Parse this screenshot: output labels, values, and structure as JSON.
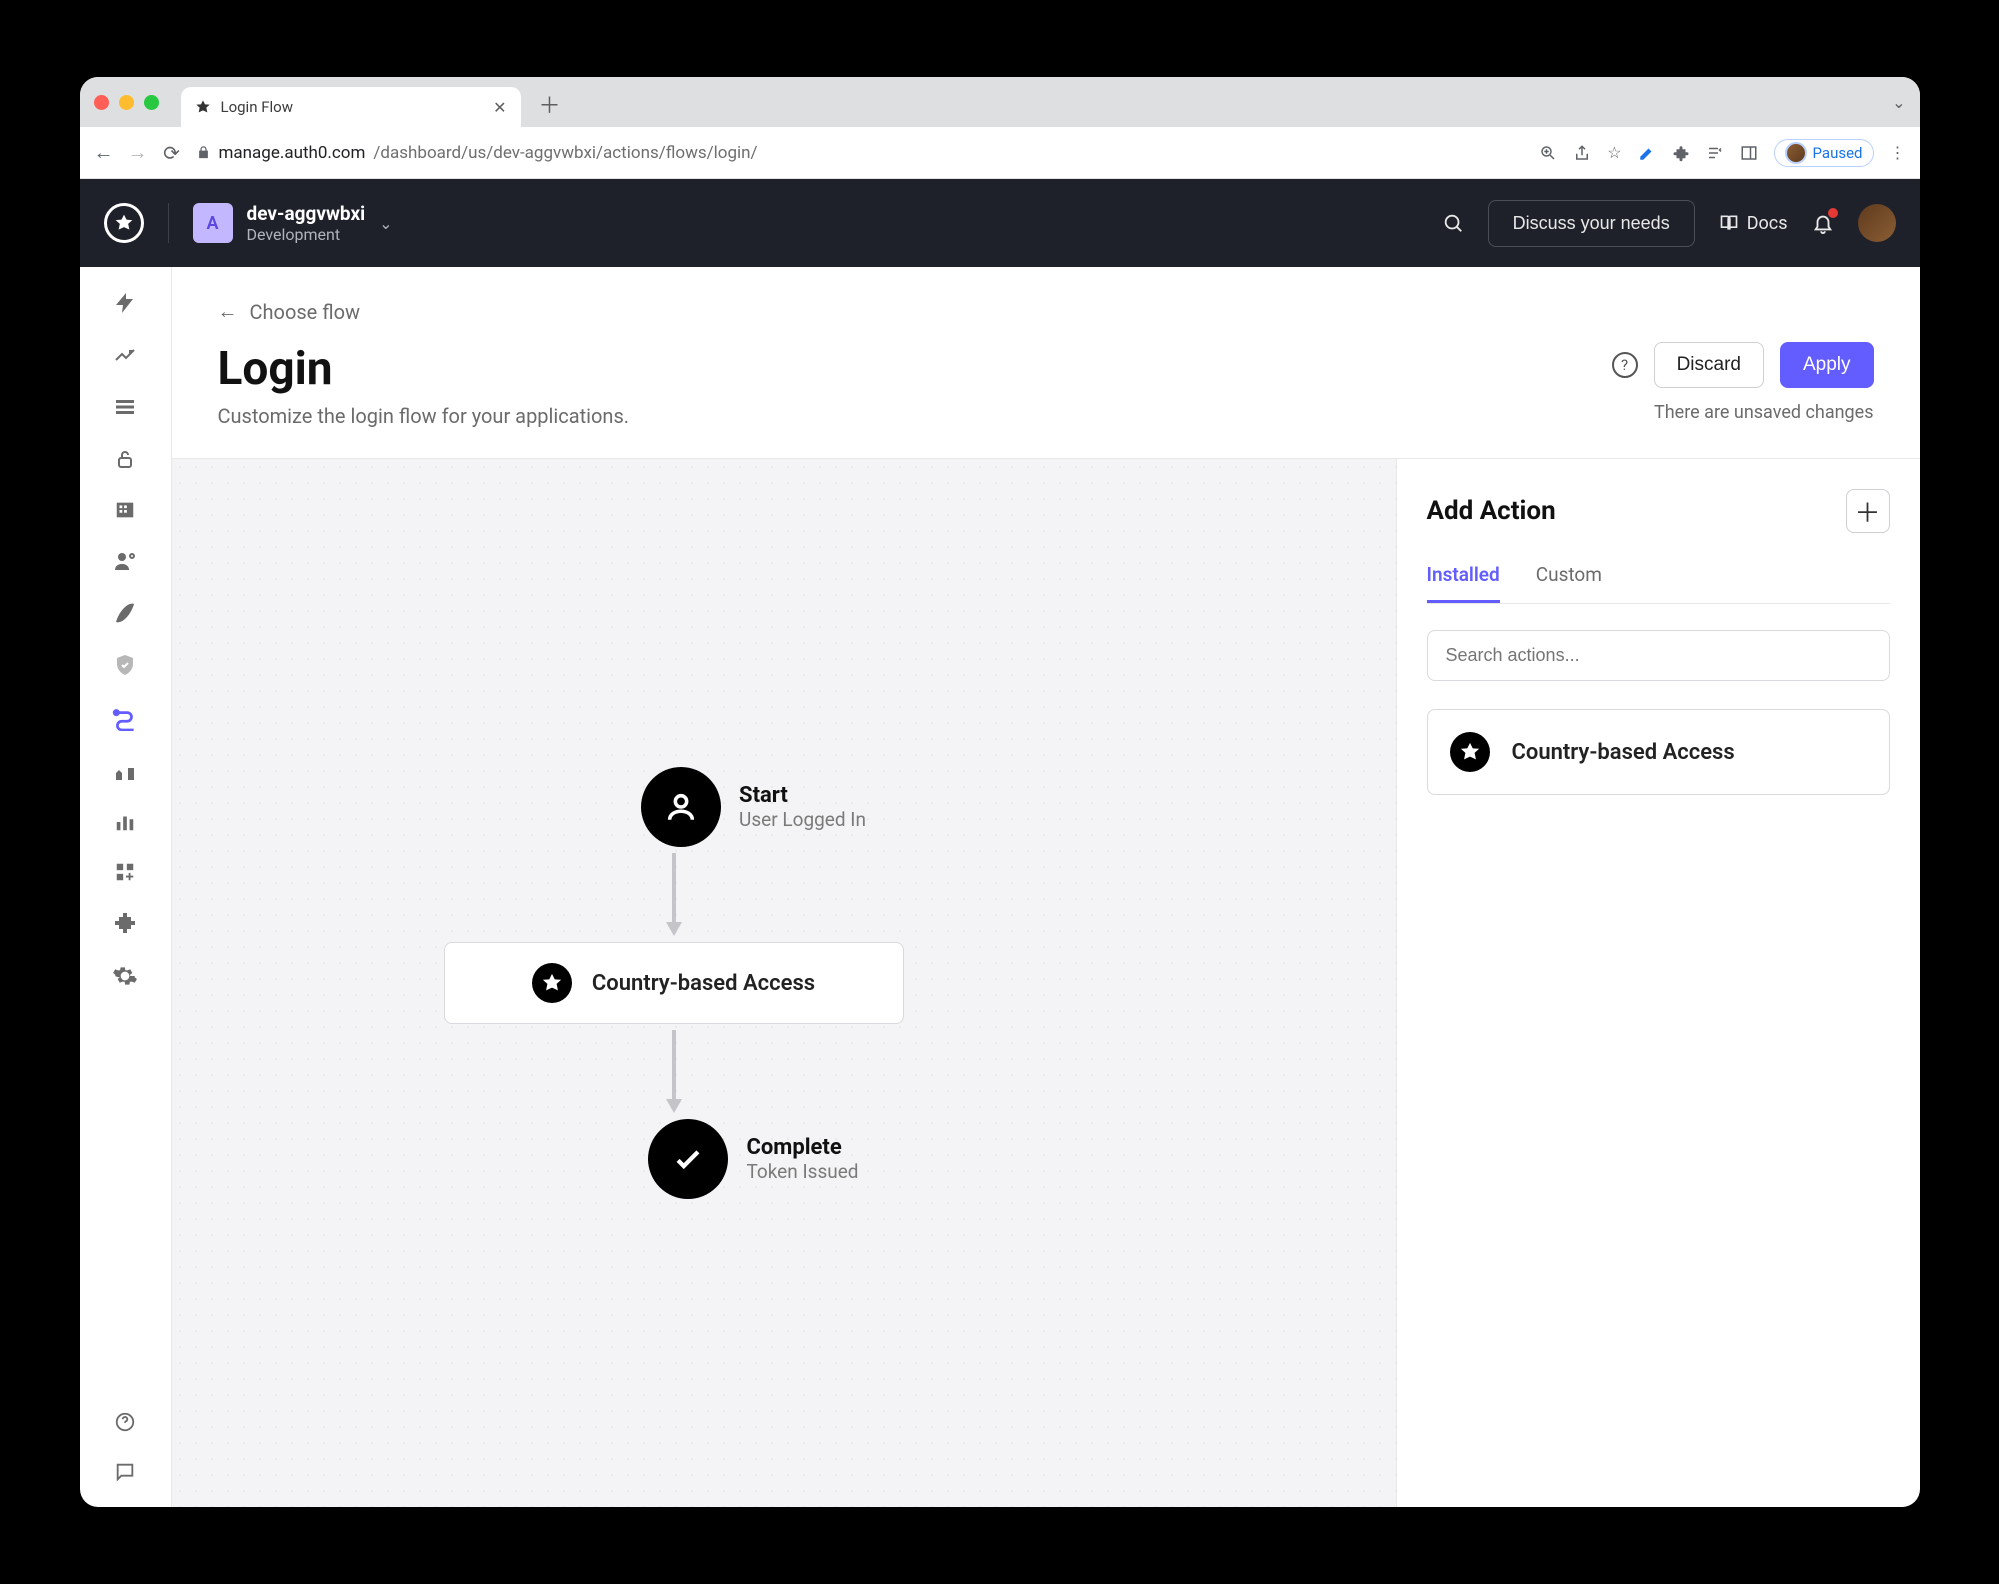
{
  "browser": {
    "tab_title": "Login Flow",
    "url_host": "manage.auth0.com",
    "url_path": "/dashboard/us/dev-aggvwbxi/actions/flows/login/",
    "profile_status": "Paused"
  },
  "header": {
    "tenant_letter": "A",
    "tenant_name": "dev-aggvwbxi",
    "tenant_env": "Development",
    "discuss_label": "Discuss your needs",
    "docs_label": "Docs"
  },
  "page": {
    "back_label": "Choose flow",
    "title": "Login",
    "subtitle": "Customize the login flow for your applications.",
    "discard_label": "Discard",
    "apply_label": "Apply",
    "unsaved_label": "There are unsaved changes"
  },
  "flow": {
    "start_title": "Start",
    "start_sub": "User Logged In",
    "action_label": "Country-based Access",
    "complete_title": "Complete",
    "complete_sub": "Token Issued"
  },
  "panel": {
    "title": "Add Action",
    "tab_installed": "Installed",
    "tab_custom": "Custom",
    "search_placeholder": "Search actions...",
    "card_label": "Country-based Access"
  }
}
